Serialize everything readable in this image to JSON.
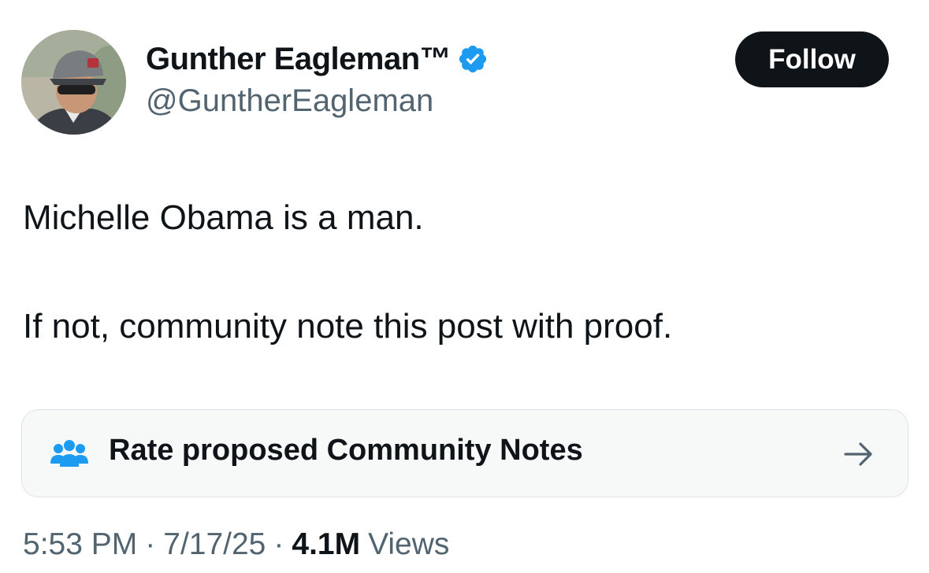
{
  "author": {
    "display_name": "Gunther Eagleman™",
    "handle": "@GuntherEagleman",
    "verified_color": "#1d9bf0",
    "avatar_icon": "avatar-photo"
  },
  "follow_button": {
    "label": "Follow"
  },
  "post": {
    "line1": "Michelle Obama is a man.",
    "line2": "If not, community note this post with proof."
  },
  "community_notes": {
    "label": "Rate proposed Community Notes",
    "icon": "people-icon",
    "icon_color": "#1d9bf0",
    "arrow": "→"
  },
  "meta": {
    "time": "5:53 PM",
    "separator": "·",
    "date": "7/17/25",
    "views_count": "4.1M",
    "views_label": "Views"
  }
}
